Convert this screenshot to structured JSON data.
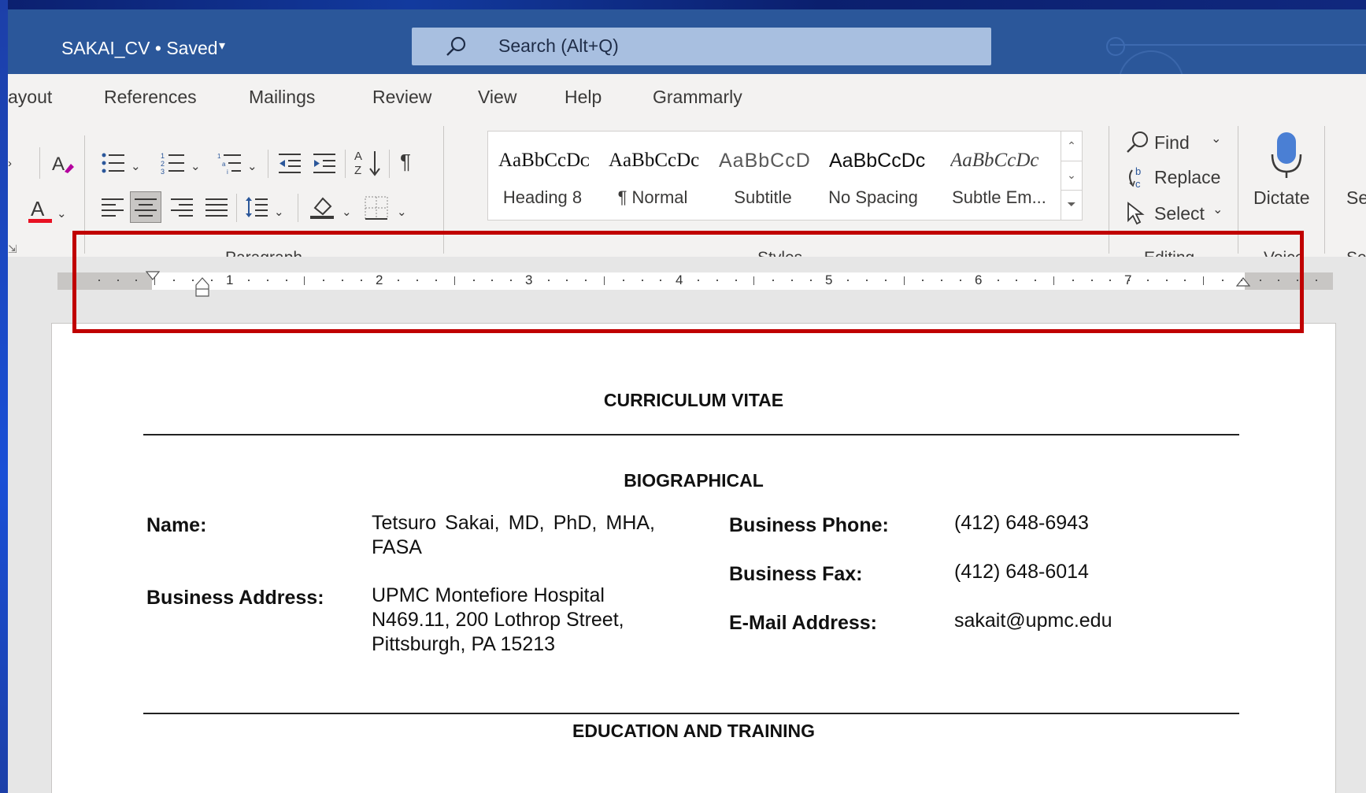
{
  "window": {
    "title": "SAKAI_CV • Saved"
  },
  "search": {
    "placeholder": "Search (Alt+Q)"
  },
  "tabs": [
    "ayout",
    "References",
    "Mailings",
    "Review",
    "View",
    "Help",
    "Grammarly"
  ],
  "styles": [
    {
      "sample": "AaBbCcDᴄ",
      "name": "Heading 8"
    },
    {
      "sample": "AaBbCcDc",
      "name": "¶ Normal"
    },
    {
      "sample": "AaBbCcD",
      "name": "Subtitle"
    },
    {
      "sample": "AaBbCcDc",
      "name": "No Spacing"
    },
    {
      "sample": "AaBbCcDc",
      "name": "Subtle Em..."
    }
  ],
  "editing": {
    "find": "Find",
    "replace": "Replace",
    "select": "Select"
  },
  "voice": {
    "dictate": "Dictate"
  },
  "groups": {
    "paragraph": "Paragraph",
    "styles": "Styles",
    "editing": "Editing",
    "voice": "Voice",
    "sensitivity_partial": "Se",
    "sensitivity_button_partial": "Se"
  },
  "ruler": {
    "numbers": [
      "1",
      "2",
      "3",
      "4",
      "5",
      "6",
      "7"
    ]
  },
  "document": {
    "title": "CURRICULUM VITAE",
    "section_bio": "BIOGRAPHICAL",
    "name_label": "Name:",
    "name_value": "Tetsuro  Sakai,  MD,  PhD, MHA, FASA",
    "address_label": "Business Address:",
    "address_value": "UPMC  Montefiore  Hospital N469.11, 200 Lothrop Street, Pittsburgh, PA  15213",
    "phone_label": "Business Phone:",
    "phone_value": "(412) 648-6943",
    "fax_label": "Business Fax:",
    "fax_value": "(412) 648-6014",
    "email_label": "E-Mail Address:",
    "email_value": "sakait@upmc.edu",
    "section_edu": "EDUCATION AND TRAINING"
  },
  "colors": {
    "title_bar": "#2b579a",
    "search_box": "#a8bfe0",
    "highlight": "#c00000",
    "font_color_red": "#e81123",
    "dictate_blue": "#4a7fd4"
  }
}
